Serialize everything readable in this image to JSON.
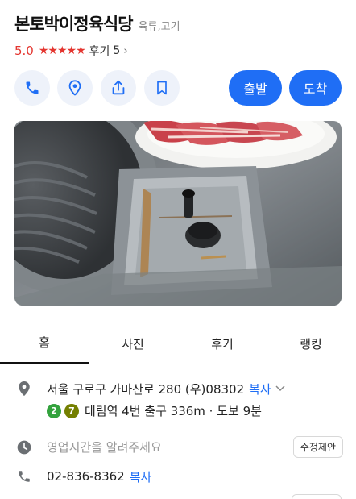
{
  "place": {
    "name": "본토박이정육식당",
    "category": "육류,고기",
    "rating": "5.0",
    "stars": "★★★★★",
    "review_label": "후기",
    "review_count": "5",
    "review_chevron": "›"
  },
  "actions": {
    "call_icon": "phone-icon",
    "map_icon": "map-pin-icon",
    "share_icon": "share-icon",
    "bookmark_icon": "bookmark-icon",
    "depart_label": "출발",
    "arrive_label": "도착",
    "accent_color": "#1f6ef5"
  },
  "tabs": [
    {
      "label": "홈",
      "active": true
    },
    {
      "label": "사진",
      "active": false
    },
    {
      "label": "후기",
      "active": false
    },
    {
      "label": "랭킹",
      "active": false
    }
  ],
  "info": {
    "address": "서울 구로구 가마산로 280 (우)08302",
    "copy_label": "복사",
    "subway_line_2": "2",
    "subway_line_7": "7",
    "subway_line_2_color": "#33a23d",
    "subway_line_7_color": "#747f00",
    "directions": "대림역 4번 출구 336m · 도보 9분",
    "hours": "영업시간을 알려주세요",
    "suggest_edit_label": "수정제안",
    "phone": "02-836-8362",
    "phone_copy_label": "복사"
  }
}
